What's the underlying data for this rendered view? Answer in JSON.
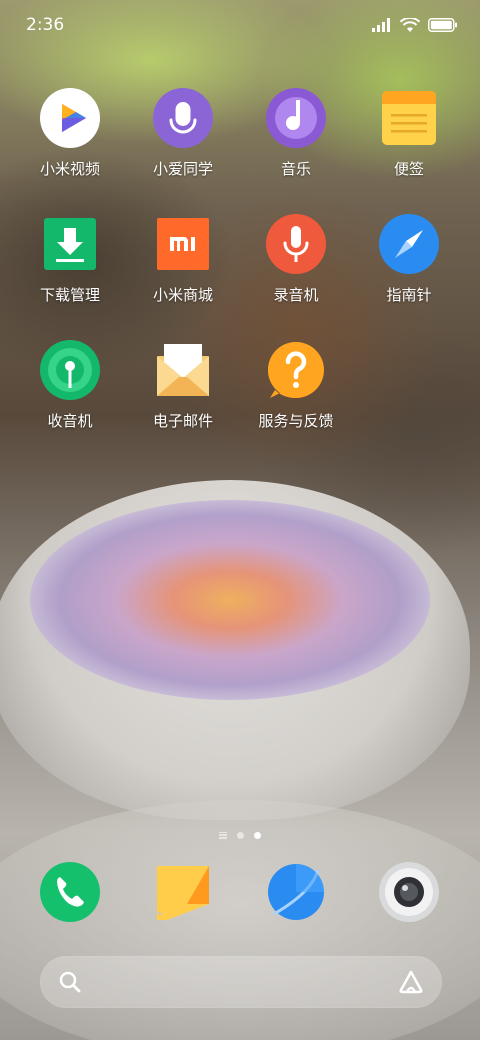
{
  "status_bar": {
    "time": "2:36",
    "icons": [
      "signal-icon",
      "wifi-icon",
      "battery-icon"
    ]
  },
  "apps": [
    {
      "label": "小米视频",
      "icon": "mi-video-icon",
      "color": "#ffffff"
    },
    {
      "label": "小爱同学",
      "icon": "xiaoai-icon",
      "color": "#8b65d6"
    },
    {
      "label": "音乐",
      "icon": "music-icon",
      "color": "#8a5ad4"
    },
    {
      "label": "便签",
      "icon": "notes-icon",
      "color": "#ffc233"
    },
    {
      "label": "下载管理",
      "icon": "download-icon",
      "color": "#13b86b"
    },
    {
      "label": "小米商城",
      "icon": "mi-store-icon",
      "color": "#ff6a2b"
    },
    {
      "label": "录音机",
      "icon": "recorder-icon",
      "color": "#f05a3c"
    },
    {
      "label": "指南针",
      "icon": "compass-icon",
      "color": "#2a8cf0"
    },
    {
      "label": "收音机",
      "icon": "radio-icon",
      "color": "#14b86b"
    },
    {
      "label": "电子邮件",
      "icon": "email-icon",
      "color": "#f6c870"
    },
    {
      "label": "服务与反馈",
      "icon": "help-icon",
      "color": "#ffa51f"
    }
  ],
  "page_indicator": {
    "pages": 2,
    "current": 2
  },
  "dock": [
    {
      "name": "phone",
      "icon": "phone-icon",
      "color": "#14c06c"
    },
    {
      "name": "messages",
      "icon": "message-icon",
      "color": "#ffb020"
    },
    {
      "name": "browser",
      "icon": "browser-icon",
      "color": "#2a8cf0"
    },
    {
      "name": "camera",
      "icon": "camera-icon",
      "color": "#d9dadc"
    }
  ],
  "search": {
    "icon": "search-icon",
    "assistant_icon": "xiaoai-assistant-icon"
  }
}
